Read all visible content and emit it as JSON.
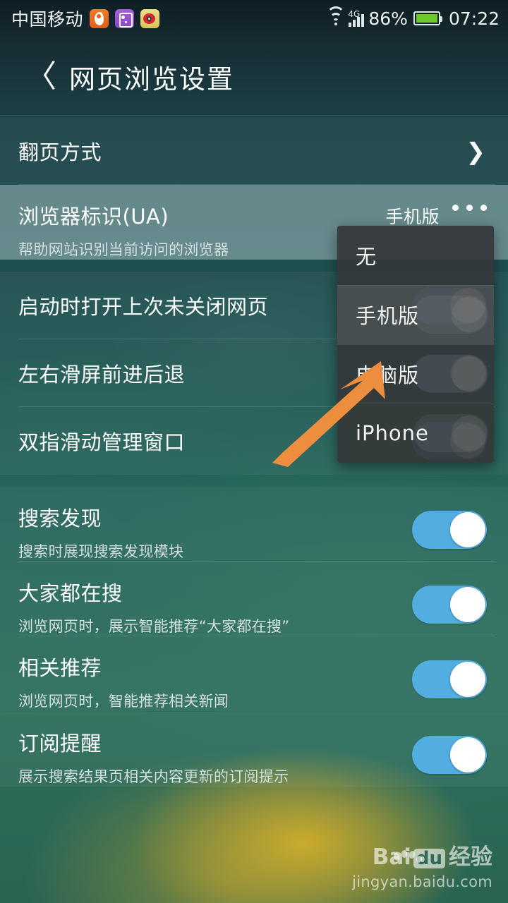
{
  "status_bar": {
    "carrier": "中国移动",
    "app_icons": [
      "uc-browser-icon",
      "gallery-icon",
      "weibo-icon"
    ],
    "wifi": "wifi-icon",
    "network_type": "4G",
    "signal": "signal-bars-icon",
    "battery_percent": "86%",
    "battery": "battery-charging-icon",
    "clock": "07:22"
  },
  "header": {
    "back": "〈",
    "title": "网页浏览设置"
  },
  "sections": [
    {
      "id": "ua",
      "rows": [
        {
          "title": "翻页方式",
          "sub": "",
          "control": "chevron",
          "chevron": "❯"
        },
        {
          "title": "浏览器标识(UA)",
          "sub": "帮助网站识别当前访问的浏览器",
          "control": "value",
          "value": "手机版",
          "highlighted": true
        }
      ]
    },
    {
      "id": "browse",
      "rows": [
        {
          "title": "启动时打开上次未关闭网页",
          "sub": "",
          "control": "toggle",
          "on": true
        },
        {
          "title": "左右滑屏前进后退",
          "sub": "",
          "control": "toggle",
          "on": true
        },
        {
          "title": "双指滑动管理窗口",
          "sub": "",
          "control": "toggle",
          "on": true
        }
      ]
    },
    {
      "id": "search",
      "rows": [
        {
          "title": "搜索发现",
          "sub": "搜索时展现搜索发现模块",
          "control": "toggle",
          "on": true
        },
        {
          "title": "大家都在搜",
          "sub": "浏览网页时，展示智能推荐“大家都在搜”",
          "control": "toggle",
          "on": true
        },
        {
          "title": "相关推荐",
          "sub": "浏览网页时，智能推荐相关新闻",
          "control": "toggle",
          "on": true
        }
      ]
    },
    {
      "id": "subscribe",
      "rows": [
        {
          "title": "订阅提醒",
          "sub": "展示搜索结果页相关内容更新的订阅提示",
          "control": "toggle",
          "on": true
        }
      ]
    }
  ],
  "ua_dropdown": {
    "options": [
      {
        "label": "无",
        "selected": false
      },
      {
        "label": "手机版",
        "selected": true
      },
      {
        "label": "电脑版",
        "selected": false
      },
      {
        "label": "iPhone",
        "selected": false
      }
    ]
  },
  "annotation": {
    "arrow_color": "#ED8E3F",
    "points_to": "电脑版"
  },
  "watermark": {
    "bai": "Bai",
    "du": "du",
    "jingyan": "经验",
    "url": "jingyan.baidu.com"
  },
  "colors": {
    "toggle_on": "#52aee0",
    "accent_arrow": "#ED8E3F",
    "text_primary": "#ffffff",
    "text_secondary": "#d4e0e0",
    "dropdown_bg": "#343738"
  }
}
